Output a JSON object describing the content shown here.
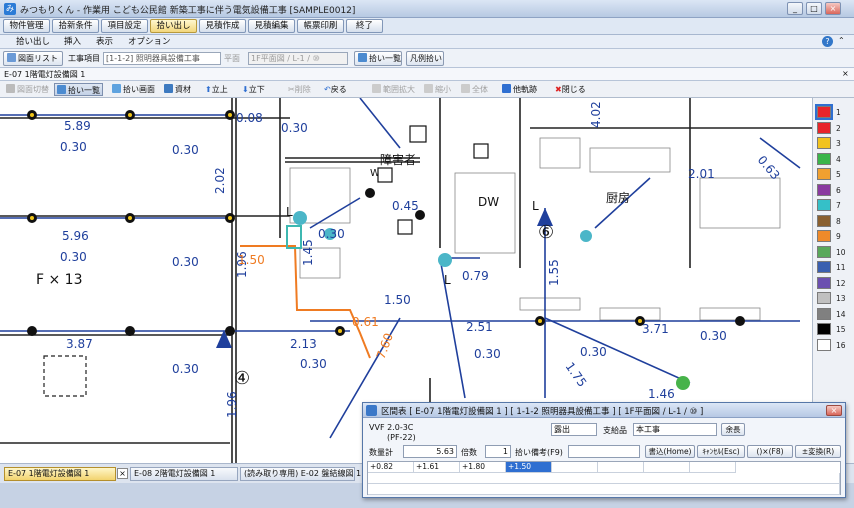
{
  "window": {
    "title": "みつもりくん - 作業用 こども公民館 新築工事に伴う電気設備工事 [SAMPLE0012]",
    "controls": [
      "_",
      "□",
      "×"
    ]
  },
  "menubar": {
    "items": [
      "物件管理",
      "拾新条件",
      "項目設定",
      "拾い出し",
      "見積作成",
      "見積編集",
      "帳票印刷",
      "終了"
    ],
    "active_index": 3
  },
  "submenu": {
    "items": [
      "拾い出し",
      "挿入",
      "表示",
      "オプション"
    ]
  },
  "toolbar1": {
    "drawing_list": "図面リスト",
    "construction_item_label": "工事項目",
    "construction_item_value": "[1-1-2] 照明器具設備工事",
    "plan_label": "平面",
    "plan_value": "1F平面図 / L-1 / ⑩",
    "pickup_list_button": "拾い一覧",
    "legend_button": "凡例拾い"
  },
  "drawing_tab": {
    "label": "E-07 1階電灯設備図 1"
  },
  "toolbar2": {
    "items": [
      {
        "label": "図面切替",
        "enabled": false
      },
      {
        "label": "拾い一覧",
        "enabled": true,
        "pressed": true
      },
      {
        "label": "拾い画面",
        "enabled": true
      },
      {
        "label": "資材",
        "enabled": true
      },
      {
        "label": "立上",
        "enabled": true
      },
      {
        "label": "立下",
        "enabled": true
      },
      {
        "label": "削除",
        "enabled": false
      },
      {
        "label": "戻る",
        "enabled": true
      },
      {
        "label": "範囲拡大",
        "enabled": false
      },
      {
        "label": "縮小",
        "enabled": false
      },
      {
        "label": "全体",
        "enabled": false
      },
      {
        "label": "他軌跡",
        "enabled": true
      },
      {
        "label": "閉じる",
        "enabled": true
      }
    ]
  },
  "drawing": {
    "labels": [
      {
        "text": "5.89"
      },
      {
        "text": "0.30"
      },
      {
        "text": "0.30"
      },
      {
        "text": "0.30"
      },
      {
        "text": "2.02"
      },
      {
        "text": "5.96"
      },
      {
        "text": "0.30"
      },
      {
        "text": "0.30"
      },
      {
        "text": "1.96"
      },
      {
        "text": "1.50"
      },
      {
        "text": "1.45"
      },
      {
        "text": "0.30"
      },
      {
        "text": "0.45"
      },
      {
        "text": "0.79"
      },
      {
        "text": "1.55"
      },
      {
        "text": "1.50"
      },
      {
        "text": "2.51"
      },
      {
        "text": "0.30"
      },
      {
        "text": "3.87"
      },
      {
        "text": "0.30"
      },
      {
        "text": "2.13"
      },
      {
        "text": "0.30"
      },
      {
        "text": "0.61"
      },
      {
        "text": "7.60"
      },
      {
        "text": "1.46"
      },
      {
        "text": "1.75"
      },
      {
        "text": "3.71"
      },
      {
        "text": "0.30"
      },
      {
        "text": "0.30"
      },
      {
        "text": "2.01"
      },
      {
        "text": "0.63"
      },
      {
        "text": "4.02"
      },
      {
        "text": "0.08"
      },
      {
        "text": "1.96"
      }
    ],
    "room_labels": [
      "WC",
      "障害者",
      "DW",
      "厨房",
      "L",
      "L",
      "L"
    ],
    "symbol_counter": "F × 13",
    "circle_numbers": [
      "④",
      "⑥"
    ]
  },
  "palette": {
    "numbers": [
      "1",
      "2",
      "3",
      "4",
      "5",
      "6",
      "7",
      "8",
      "9",
      "10",
      "11",
      "12",
      "13",
      "14",
      "15",
      "16"
    ],
    "colors": [
      "#e8242a",
      "#e8242a",
      "#f2c31e",
      "#3ab54a",
      "#f0a030",
      "#8a3aa0",
      "#35c0c8",
      "#8a6030",
      "#ef8a2a",
      "#59a85a",
      "#3a5fb0",
      "#6b4fb0",
      "#c0c0c0",
      "#808080",
      "#000000",
      "#ffffff"
    ]
  },
  "bottom_tabs": [
    {
      "label": "E-07 1階電灯設備図 1",
      "active": true
    },
    {
      "label": "E-08 2階電灯設備図 1",
      "active": false
    },
    {
      "label": "(読み取り専用) E-02 盤結線図 1",
      "active": false
    }
  ],
  "dialog": {
    "title": "区間表 [ E-07 1階電灯設備図 1 ] [ 1-1-2 照明器具設備工事 ] [ 1F平面図 / L-1 / ⑩ ]",
    "material": "VVF 2.0-3C",
    "material_sub": "(PF-22)",
    "exposure": "露出",
    "spec_label": "支給品",
    "spec_value": "本工事",
    "remaining_button": "余長",
    "qty_label": "数量計",
    "qty_value": "5.63",
    "multiplier_label": "倍数",
    "multiplier_value": "1",
    "note_label": "拾い備考(F9)",
    "buttons": [
      "書込(Home)",
      "ｷｬﾝｾﾙ(Esc)",
      "()×(F8)",
      "±変換(R)"
    ],
    "rows": [
      [
        "+0.82",
        "+1.61",
        "+1.80",
        "+1.50",
        "",
        "",
        "",
        ""
      ]
    ]
  }
}
